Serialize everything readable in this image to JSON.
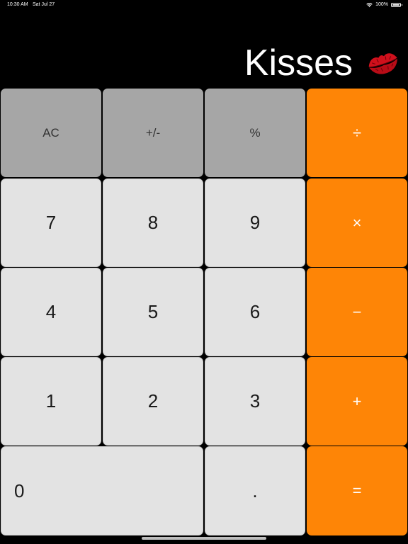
{
  "status_bar": {
    "time": "10:30 AM",
    "date": "Sat Jul 27",
    "battery": "100%",
    "icons": [
      "wifi-icon",
      "battery-icon"
    ]
  },
  "display": {
    "value": "Kisses",
    "emoji_icon": "kiss-mark-icon"
  },
  "colors": {
    "background": "#000000",
    "function_key": "#a6a6a6",
    "digit_key": "#e3e3e3",
    "operator_key": "#fe8506",
    "operator_text": "#ffffff"
  },
  "keypad": {
    "ac": "AC",
    "plus_minus": "+/-",
    "percent": "%",
    "divide": "÷",
    "seven": "7",
    "eight": "8",
    "nine": "9",
    "multiply": "×",
    "four": "4",
    "five": "5",
    "six": "6",
    "minus": "−",
    "one": "1",
    "two": "2",
    "three": "3",
    "plus": "+",
    "zero": "0",
    "decimal": ".",
    "equals": "="
  }
}
